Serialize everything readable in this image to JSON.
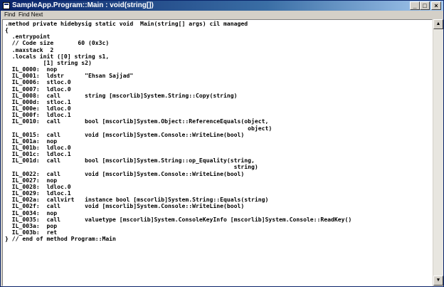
{
  "window": {
    "title": "SampleApp.Program::Main : void(string[])",
    "buttons": {
      "minimize": "_",
      "maximize": "□",
      "close": "×"
    }
  },
  "menu": {
    "find": "Find",
    "find_next": "Find Next"
  },
  "scrollbar": {
    "up_arrow": "▲",
    "down_arrow": "▼"
  },
  "code_lines": [
    ".method private hidebysig static void  Main(string[] args) cil managed",
    "{",
    "  .entrypoint",
    "  // Code size       60 (0x3c)",
    "  .maxstack  2",
    "  .locals init ([0] string s1,",
    "           [1] string s2)",
    "  IL_0000:  nop",
    "  IL_0001:  ldstr      \"Ehsan Sajjad\"",
    "  IL_0006:  stloc.0",
    "  IL_0007:  ldloc.0",
    "  IL_0008:  call       string [mscorlib]System.String::Copy(string)",
    "  IL_000d:  stloc.1",
    "  IL_000e:  ldloc.0",
    "  IL_000f:  ldloc.1",
    "  IL_0010:  call       bool [mscorlib]System.Object::ReferenceEquals(object,",
    "                                                                      object)",
    "  IL_0015:  call       void [mscorlib]System.Console::WriteLine(bool)",
    "  IL_001a:  nop",
    "  IL_001b:  ldloc.0",
    "  IL_001c:  ldloc.1",
    "  IL_001d:  call       bool [mscorlib]System.String::op_Equality(string,",
    "                                                                  string)",
    "  IL_0022:  call       void [mscorlib]System.Console::WriteLine(bool)",
    "  IL_0027:  nop",
    "  IL_0028:  ldloc.0",
    "  IL_0029:  ldloc.1",
    "  IL_002a:  callvirt   instance bool [mscorlib]System.String::Equals(string)",
    "  IL_002f:  call       void [mscorlib]System.Console::WriteLine(bool)",
    "  IL_0034:  nop",
    "  IL_0035:  call       valuetype [mscorlib]System.ConsoleKeyInfo [mscorlib]System.Console::ReadKey()",
    "  IL_003a:  pop",
    "  IL_003b:  ret",
    "} // end of method Program::Main"
  ]
}
